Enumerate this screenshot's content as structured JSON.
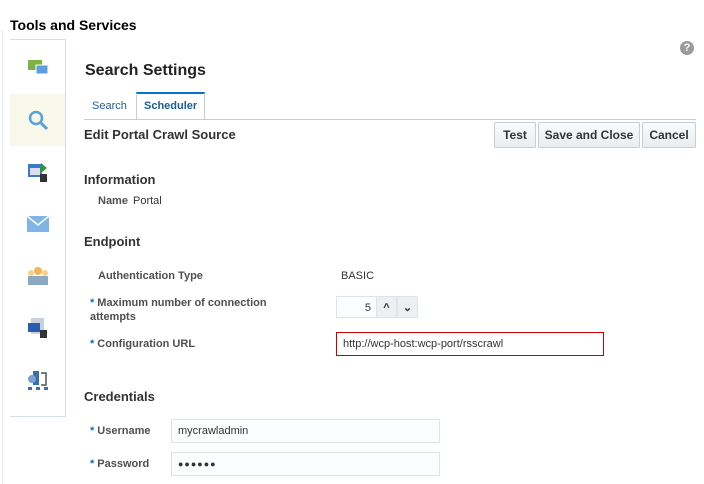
{
  "app_title": "Tools and Services",
  "sidebar": {
    "items": [
      {
        "icon": "discussions-icon"
      },
      {
        "icon": "search-icon",
        "selected": true
      },
      {
        "icon": "portal-connect-icon"
      },
      {
        "icon": "mail-icon"
      },
      {
        "icon": "people-icon"
      },
      {
        "icon": "content-connect-icon"
      },
      {
        "icon": "workflow-icon"
      }
    ]
  },
  "page_title": "Search Settings",
  "tabs": [
    {
      "label": "Search"
    },
    {
      "label": "Scheduler"
    }
  ],
  "subtitle": "Edit Portal Crawl Source",
  "buttons": {
    "test": "Test",
    "save_close": "Save and Close",
    "cancel": "Cancel"
  },
  "information": {
    "heading": "Information",
    "name_label": "Name",
    "name_value": "Portal"
  },
  "endpoint": {
    "heading": "Endpoint",
    "auth_label": "Authentication Type",
    "auth_value": "BASIC",
    "max_label": "Maximum number of connection attempts",
    "max_value": "5",
    "url_label": "Configuration URL",
    "url_value": "http://wcp-host:wcp-port/rsscrawl"
  },
  "credentials": {
    "heading": "Credentials",
    "username_label": "Username",
    "username_value": "mycrawladmin",
    "password_label": "Password",
    "password_value": "●●●●●●"
  },
  "required_mark": "*",
  "help": "?"
}
